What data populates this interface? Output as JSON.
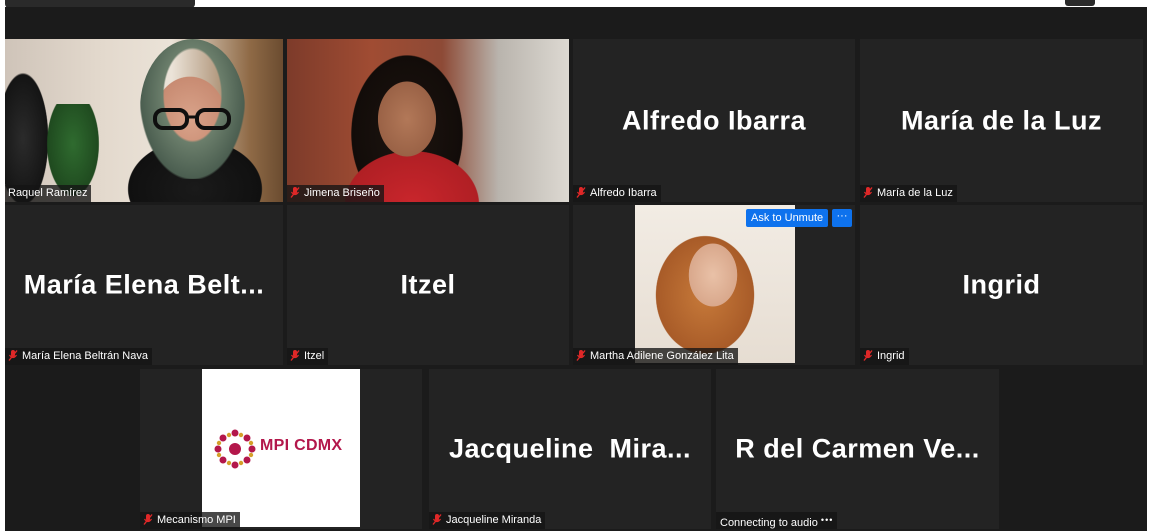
{
  "meeting": {
    "participants": [
      {
        "id": "raquel",
        "name_tag": "Raquel Ramírez",
        "video": true,
        "muted": false,
        "active_speaker": true
      },
      {
        "id": "jimena",
        "name_tag": "Jimena Briseño",
        "video": true,
        "muted": true
      },
      {
        "id": "alfredo",
        "big_name": "Alfredo Ibarra",
        "name_tag": "Alfredo Ibarra",
        "muted": true
      },
      {
        "id": "maria-luz",
        "big_name": "María de la Luz",
        "name_tag": "María de la Luz",
        "muted": true
      },
      {
        "id": "maria-elena",
        "big_name": "María Elena Belt...",
        "name_tag": "María Elena Beltrán Nava",
        "muted": true
      },
      {
        "id": "itzel",
        "big_name": "Itzel",
        "name_tag": "Itzel",
        "muted": true
      },
      {
        "id": "martha",
        "name_tag": "Martha Adilene González Lita",
        "video": true,
        "muted": true
      },
      {
        "id": "ingrid",
        "big_name": "Ingrid",
        "name_tag": "Ingrid",
        "muted": true
      },
      {
        "id": "mecanismo",
        "name_tag": "Mecanismo MPI",
        "muted": true,
        "logo_text": "MPI CDMX"
      },
      {
        "id": "jacqueline",
        "big_name": "Jacqueline  Mira...",
        "name_tag": "Jacqueline Miranda",
        "muted": true
      },
      {
        "id": "carmen",
        "big_name": "R del Carmen Ve...",
        "status": "Connecting to audio",
        "status_dots": "•••"
      }
    ],
    "hover_controls": {
      "ask_to_unmute": "Ask to Unmute",
      "more": "···"
    }
  },
  "colors": {
    "background": "#1b1b1b",
    "tile": "#232323",
    "active_speaker_border": "#d7e37a",
    "mute_icon": "#e02828",
    "button_blue": "#0e72ed",
    "mpi_magenta": "#b3174b"
  },
  "icons": {
    "muted": "microphone-muted-icon",
    "mpi_logo": "mpi-cdmx-logo"
  }
}
